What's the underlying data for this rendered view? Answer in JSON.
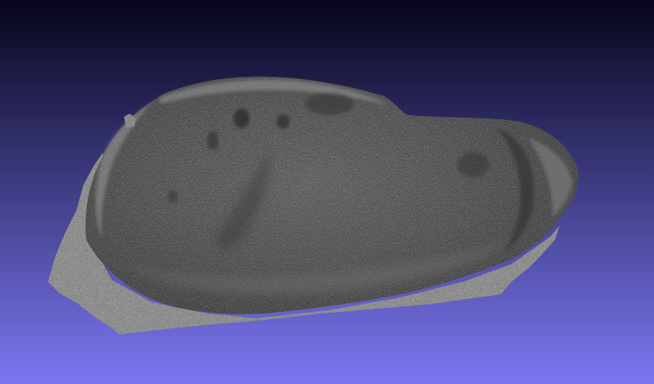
{
  "viewer": {
    "background_top_color": "#06051a",
    "background_bottom_color": "#7b77f2",
    "mesh_dark_color": "#2c2c2c",
    "mesh_mid_color": "#5c5c5c",
    "mesh_light_color": "#9a9a9a",
    "edge_highlight_color": "#c8c8c8"
  },
  "scene": {
    "object": "scanned-stone-mesh",
    "render_mode": "shaded-grayscale"
  }
}
